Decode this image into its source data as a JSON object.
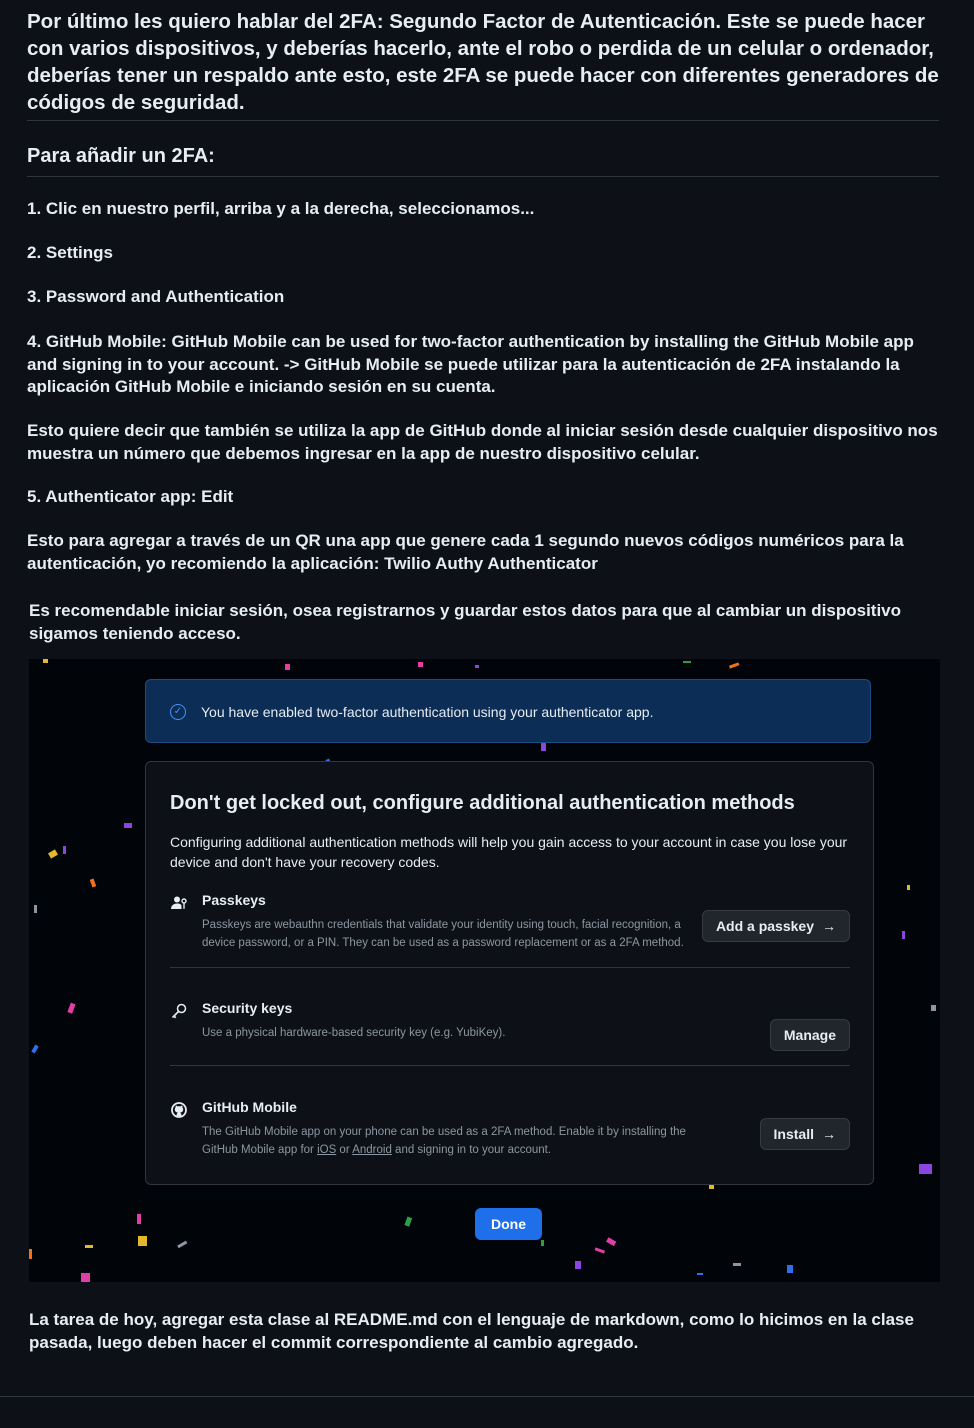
{
  "article": {
    "intro": "Por último les quiero hablar del 2FA: Segundo Factor de Autenticación. Este se puede hacer con varios dispositivos, y deberías hacerlo, ante el robo o perdida de un celular o ordenador, deberías tener un respaldo ante esto, este 2FA se puede hacer con diferentes generadores de códigos de seguridad.",
    "heading": "Para añadir un 2FA:",
    "step1": "1. Clic en nuestro perfil, arriba y a la derecha, seleccionamos...",
    "step2": "2. Settings",
    "step3": "3. Password and Authentication",
    "step4": "4. GitHub Mobile: GitHub Mobile can be used for two-factor authentication by installing the GitHub Mobile app and signing in to your account. -> GitHub Mobile se puede utilizar para la autenticación de 2FA instalando la aplicación GitHub Mobile e iniciando sesión en su cuenta.",
    "note_mobile": "Esto quiere decir que también se utiliza la app de GitHub donde al iniciar sesión desde cualquier dispositivo nos muestra un número que debemos ingresar en la app de nuestro dispositivo celular.",
    "step5": "5. Authenticator app: Edit",
    "note_app": "Esto para agregar a través de un QR una app que genere cada 1 segundo nuevos códigos numéricos para la autenticación, yo recomiendo la aplicación: Twilio Authy Authenticator",
    "note_register": "Es recomendable iniciar sesión, osea registrarnos y guardar estos datos para que al cambiar un dispositivo sigamos teniendo acceso.",
    "homework": "La tarea de hoy, agregar esta clase al README.md con el lenguaje de markdown, como lo hicimos en la clase pasada, luego deben hacer el commit correspondiente al cambio agregado."
  },
  "screenshot": {
    "flash_message": "You have enabled two-factor authentication using your authenticator app.",
    "card_title": "Don't get locked out, configure additional authentication methods",
    "card_description": "Configuring additional authentication methods will help you gain access to your account in case you lose your device and don't have your recovery codes.",
    "methods": [
      {
        "name": "Passkeys",
        "icon": "person-key-icon",
        "description": "Passkeys are webauthn credentials that validate your identity using touch, facial recognition, a device password, or a PIN. They can be used as a password replacement or as a 2FA method.",
        "button": "Add a passkey"
      },
      {
        "name": "Security keys",
        "icon": "key-icon",
        "description": "Use a physical hardware-based security key (e.g. YubiKey).",
        "button": "Manage"
      },
      {
        "name": "GitHub Mobile",
        "icon": "github-icon",
        "description_pre": "The GitHub Mobile app on your phone can be used as a 2FA method. Enable it by installing the GitHub Mobile app for ",
        "link_ios": "iOS",
        "description_mid": " or ",
        "link_android": "Android",
        "description_post": " and signing in to your account.",
        "button": "Install"
      }
    ],
    "done_button": "Done",
    "colors": {
      "page_bg": "#0d1117",
      "flash_bg": "#0c2d55",
      "primary": "#1f6feb",
      "muted_text": "#8d96a0"
    }
  }
}
